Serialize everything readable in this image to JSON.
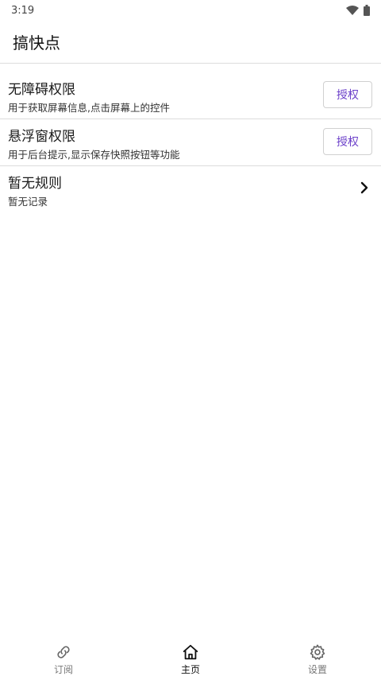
{
  "status_bar": {
    "time": "3:19",
    "icons": [
      "wifi-icon",
      "battery-icon"
    ]
  },
  "app_bar": {
    "title": "搞快点"
  },
  "list": [
    {
      "title": "无障碍权限",
      "subtitle": "用于获取屏幕信息,点击屏幕上的控件",
      "action_label": "授权"
    },
    {
      "title": "悬浮窗权限",
      "subtitle": "用于后台提示,显示保存快照按钮等功能",
      "action_label": "授权"
    },
    {
      "title": "暂无规则",
      "subtitle": "暂无记录",
      "icon": "chevron-right-icon"
    }
  ],
  "bottom_nav": {
    "items": [
      {
        "label": "订阅",
        "icon": "link-icon",
        "active": false
      },
      {
        "label": "主页",
        "icon": "home-icon",
        "active": true
      },
      {
        "label": "设置",
        "icon": "gear-icon",
        "active": false
      }
    ]
  },
  "colors": {
    "accent": "#6b3fc9",
    "divider": "#dcdcdc"
  }
}
